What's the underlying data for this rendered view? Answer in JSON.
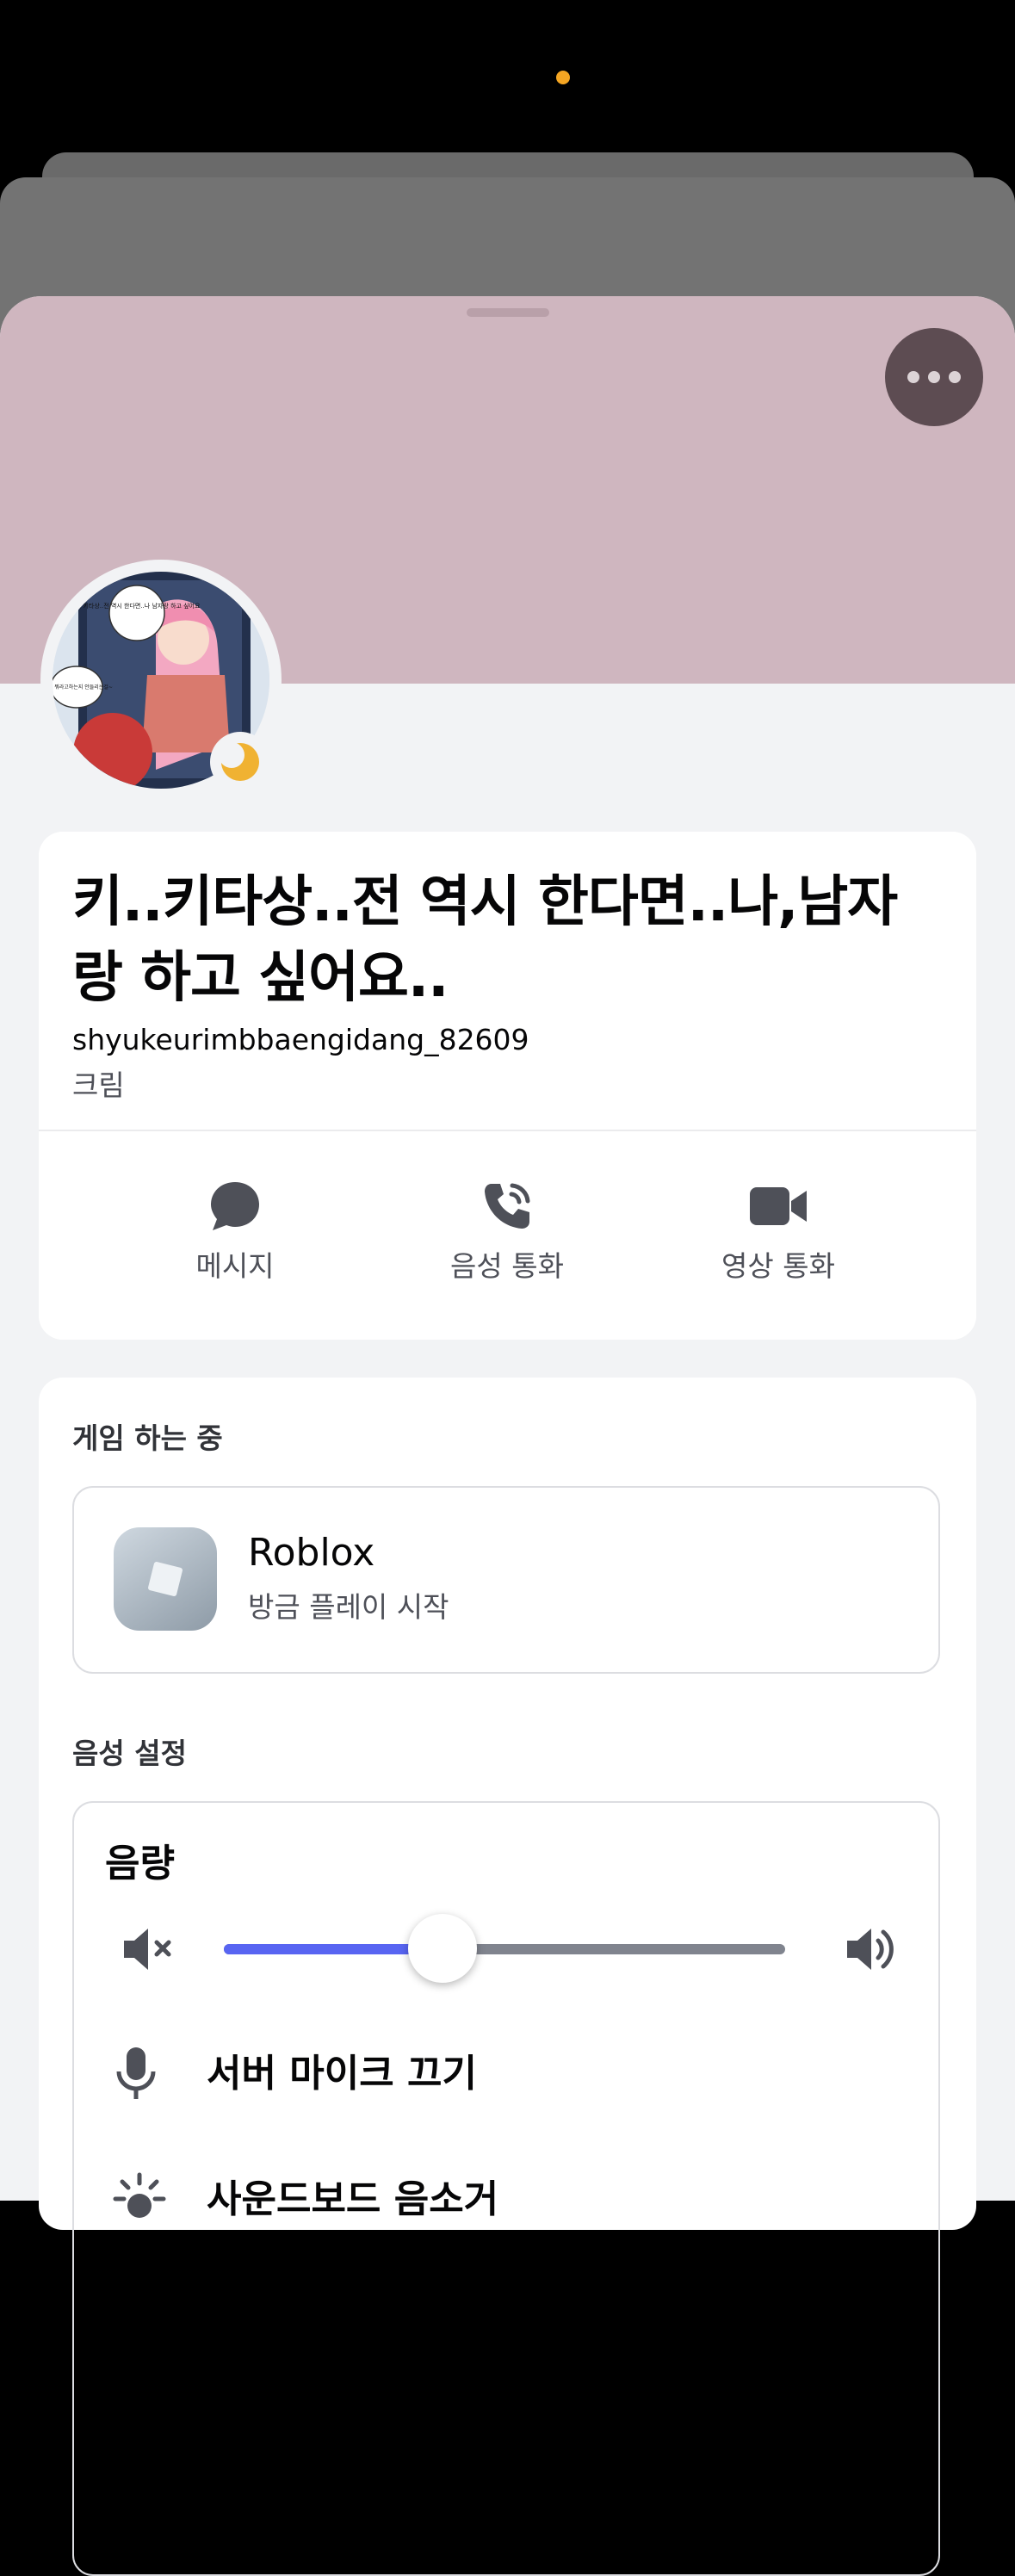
{
  "profile": {
    "display_name": "키..키타상..전 역시 한다면..나,남자랑 하고 싶어요..",
    "username": "shyukeurimbbaengidang_82609",
    "pronoun": "크림",
    "status": "idle",
    "banner_color": "#cfb6bf"
  },
  "avatar_bubbles": {
    "top": "키, 키타상..전 역시 한다면..나 남자랑 하고 싶어요",
    "left": "으음? 뭐라고하는지 안들리는걸~"
  },
  "actions": [
    {
      "label": "메시지",
      "icon": "message-icon"
    },
    {
      "label": "음성 통화",
      "icon": "phone-call-icon"
    },
    {
      "label": "영상 통화",
      "icon": "video-camera-icon"
    }
  ],
  "activity": {
    "section_title": "게임 하는 중",
    "game_name": "Roblox",
    "game_status": "방금 플레이 시작",
    "game_icon": "roblox-icon"
  },
  "voice": {
    "section_title": "음성 설정",
    "volume_label": "음량",
    "volume_level_percent": 39,
    "server_mute_label": "서버 마이크 끄기",
    "soundboard_label": "사운드보드 음소거"
  },
  "colors": {
    "accent": "#5865f2",
    "idle": "#f0b232",
    "sheet_bg": "#f2f3f5"
  }
}
